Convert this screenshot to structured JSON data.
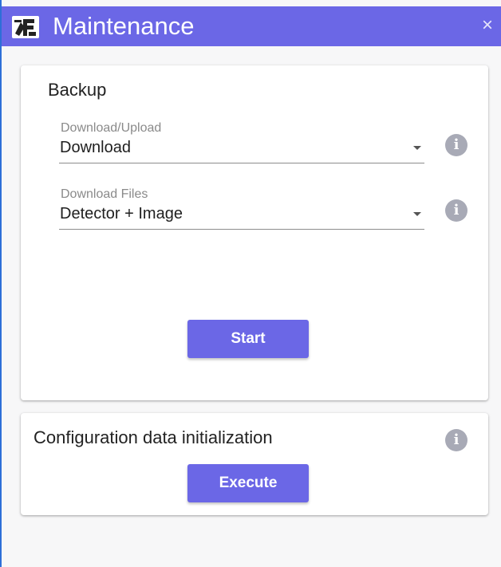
{
  "window": {
    "title": "Maintenance",
    "close_glyph": "×",
    "app_icon": "maintenance-app-icon",
    "accent_color": "#6b67e6"
  },
  "backup": {
    "title": "Backup",
    "fields": [
      {
        "label": "Download/Upload",
        "value": "Download"
      },
      {
        "label": "Download Files",
        "value": "Detector + Image"
      }
    ],
    "start_label": "Start"
  },
  "config_init": {
    "title": "Configuration data initialization",
    "execute_label": "Execute"
  },
  "info_glyph": "i"
}
